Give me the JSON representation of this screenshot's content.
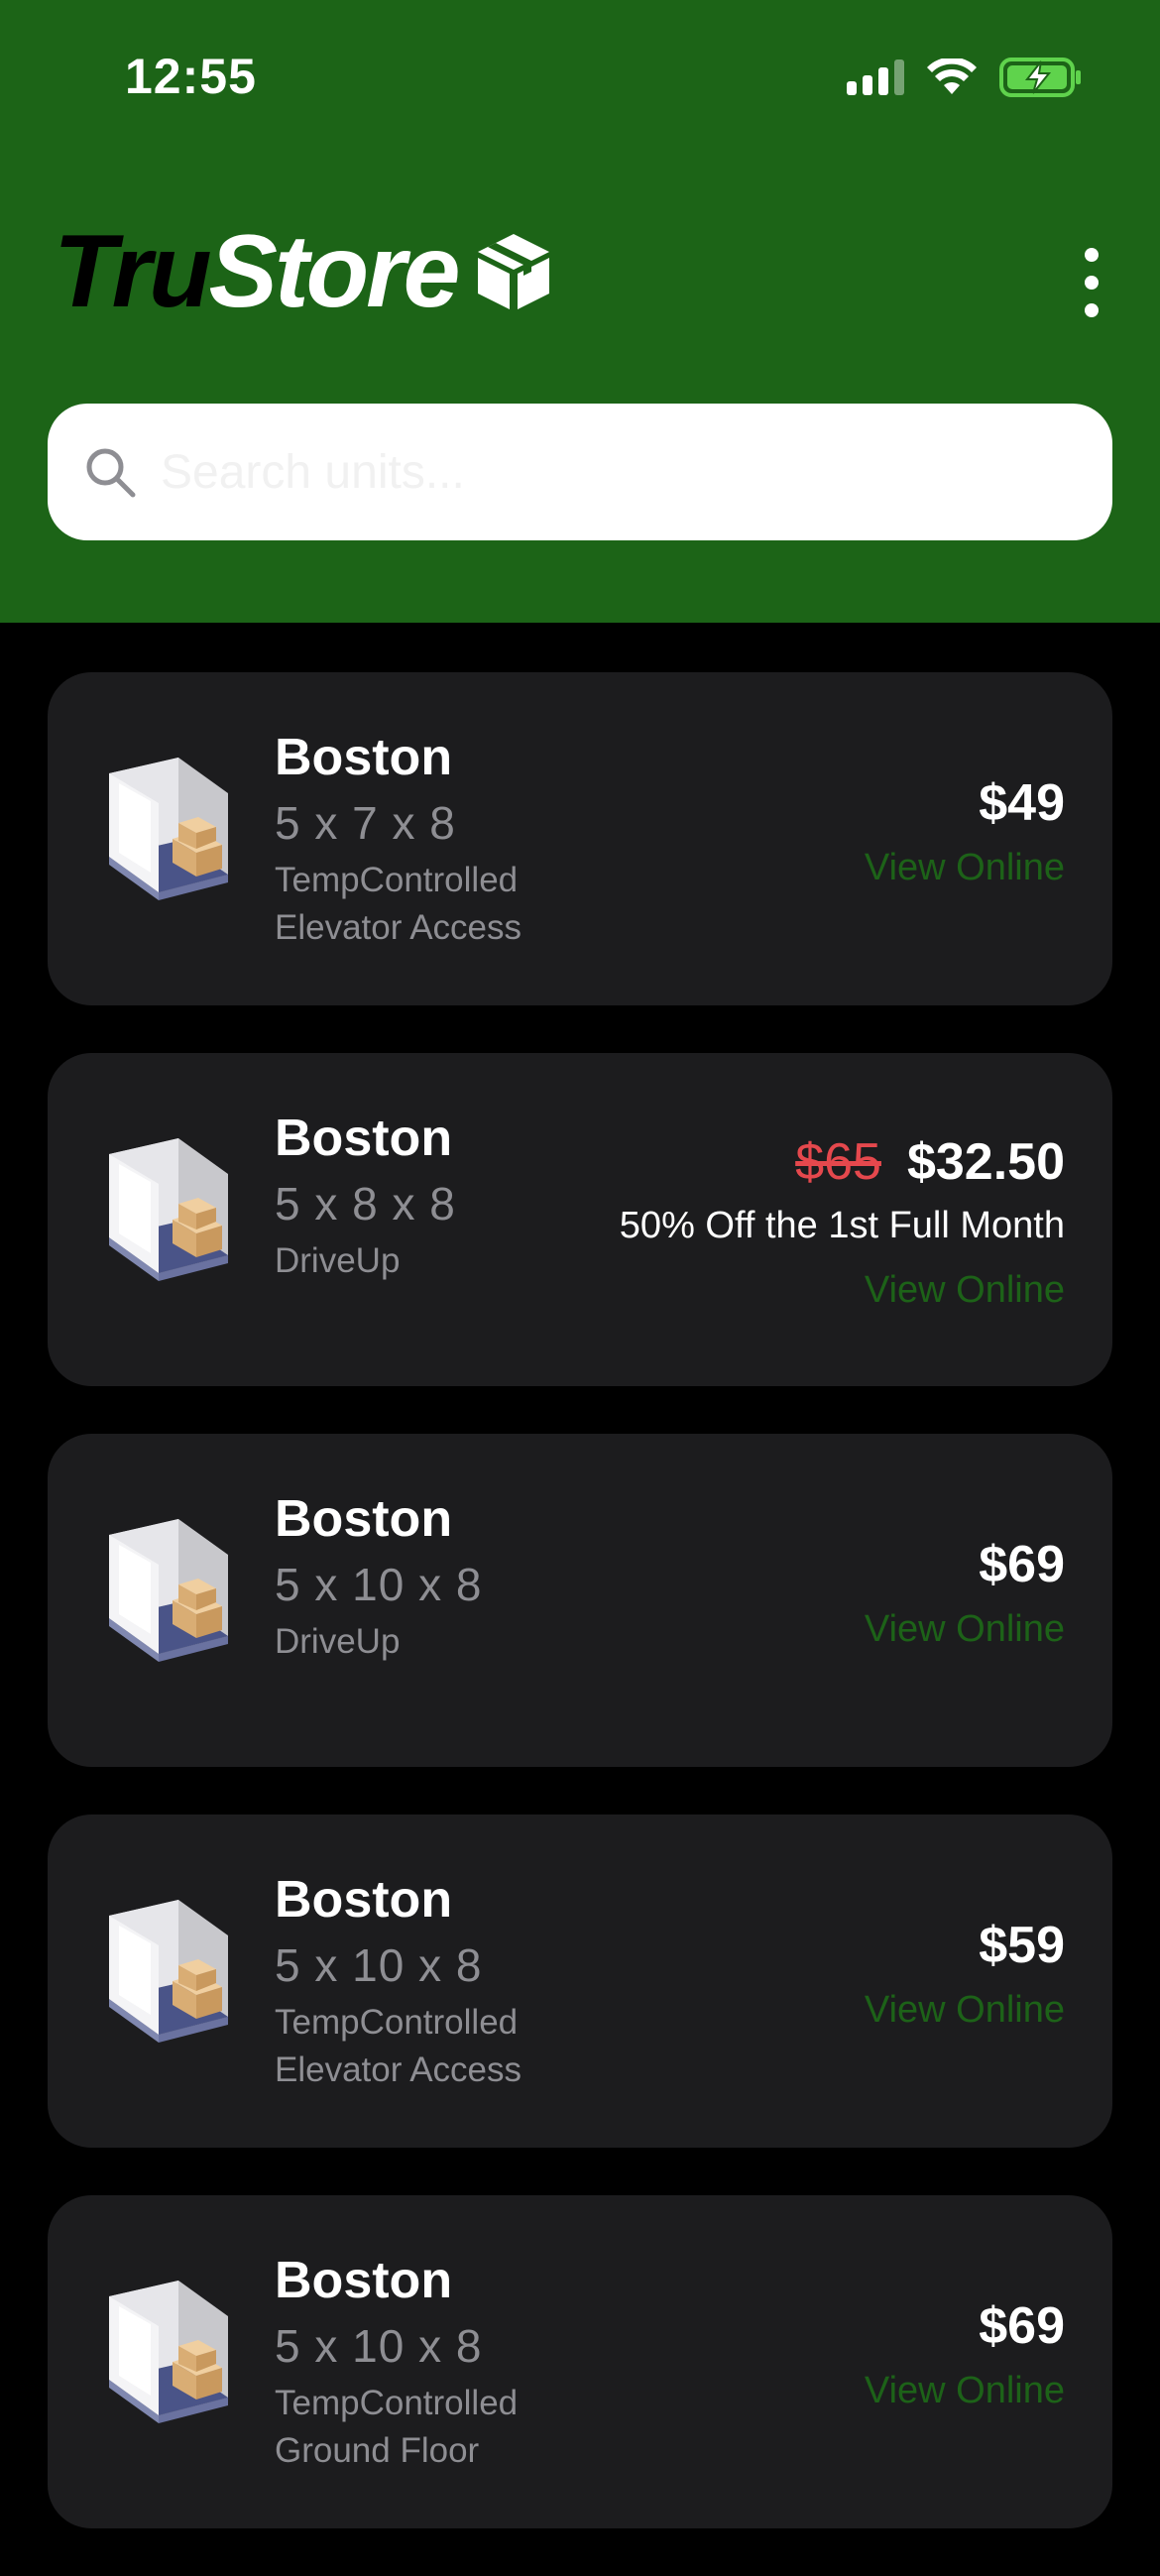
{
  "status_bar": {
    "time": "12:55"
  },
  "header": {
    "logo_part1": "Tru",
    "logo_part2": "Store",
    "logo_icon": "box-icon",
    "menu_icon": "more-vertical-icon",
    "bg_color": "#1c6417"
  },
  "search": {
    "placeholder": "Search units...",
    "value": "",
    "icon": "search-icon"
  },
  "units": [
    {
      "city": "Boston",
      "dimensions": "5 x 7 x 8",
      "features": [
        "TempControlled",
        "Elevator Access"
      ],
      "price": "$49",
      "action": "View Online"
    },
    {
      "city": "Boston",
      "dimensions": "5 x 8 x 8",
      "features": [
        "DriveUp"
      ],
      "original_price": "$65",
      "price": "$32.50",
      "promo": "50% Off the 1st Full Month",
      "action": "View Online"
    },
    {
      "city": "Boston",
      "dimensions": "5 x 10 x 8",
      "features": [
        "DriveUp"
      ],
      "price": "$69",
      "action": "View Online"
    },
    {
      "city": "Boston",
      "dimensions": "5 x 10 x 8",
      "features": [
        "TempControlled",
        "Elevator Access"
      ],
      "price": "$59",
      "action": "View Online"
    },
    {
      "city": "Boston",
      "dimensions": "5 x 10 x 8",
      "features": [
        "TempControlled",
        "Ground Floor"
      ],
      "price": "$69",
      "action": "View Online"
    }
  ],
  "colors": {
    "accent_green": "#1c6417",
    "view_online": "#1d6218",
    "strike_price": "#e5484d",
    "card_bg": "#1c1c1e",
    "page_bg": "#000000"
  }
}
